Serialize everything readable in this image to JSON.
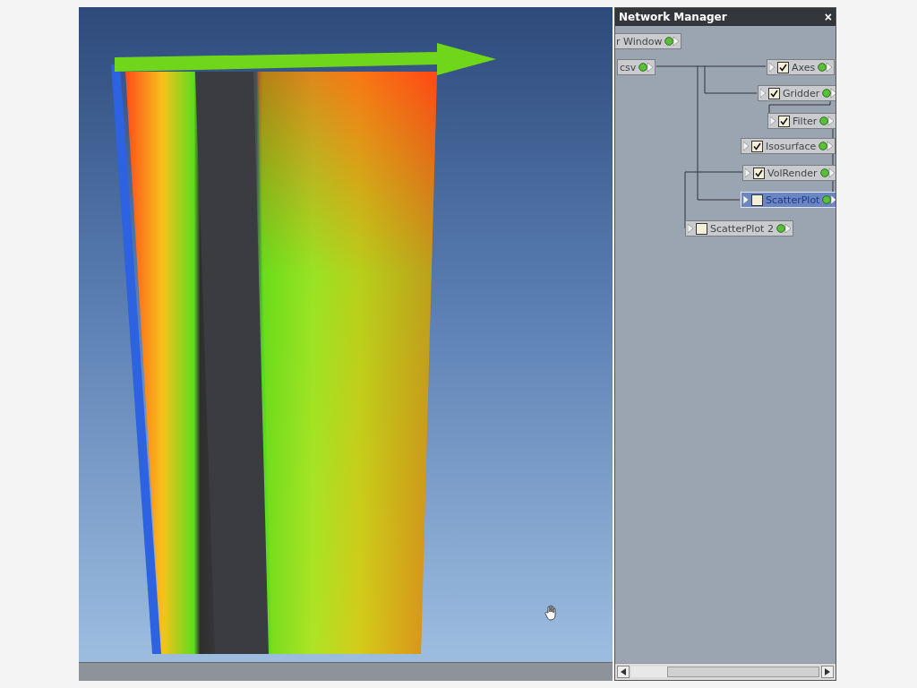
{
  "panel": {
    "title": "Network Manager",
    "close": "×"
  },
  "nodes": [
    {
      "label": "r Window",
      "kind": "source",
      "selected": false
    },
    {
      "label": "csv",
      "kind": "source",
      "selected": false
    },
    {
      "label": "Axes",
      "kind": "module",
      "checked": true,
      "selected": false
    },
    {
      "label": "Gridder",
      "kind": "module",
      "checked": true,
      "selected": false
    },
    {
      "label": "Filter",
      "kind": "module",
      "checked": true,
      "selected": false
    },
    {
      "label": "Isosurface",
      "kind": "module",
      "checked": true,
      "selected": false
    },
    {
      "label": "VolRender",
      "kind": "module",
      "checked": true,
      "selected": false
    },
    {
      "label": "ScatterPlot",
      "kind": "module",
      "checked": false,
      "selected": true
    },
    {
      "label": "ScatterPlot 2",
      "kind": "module",
      "checked": false,
      "selected": false
    }
  ]
}
